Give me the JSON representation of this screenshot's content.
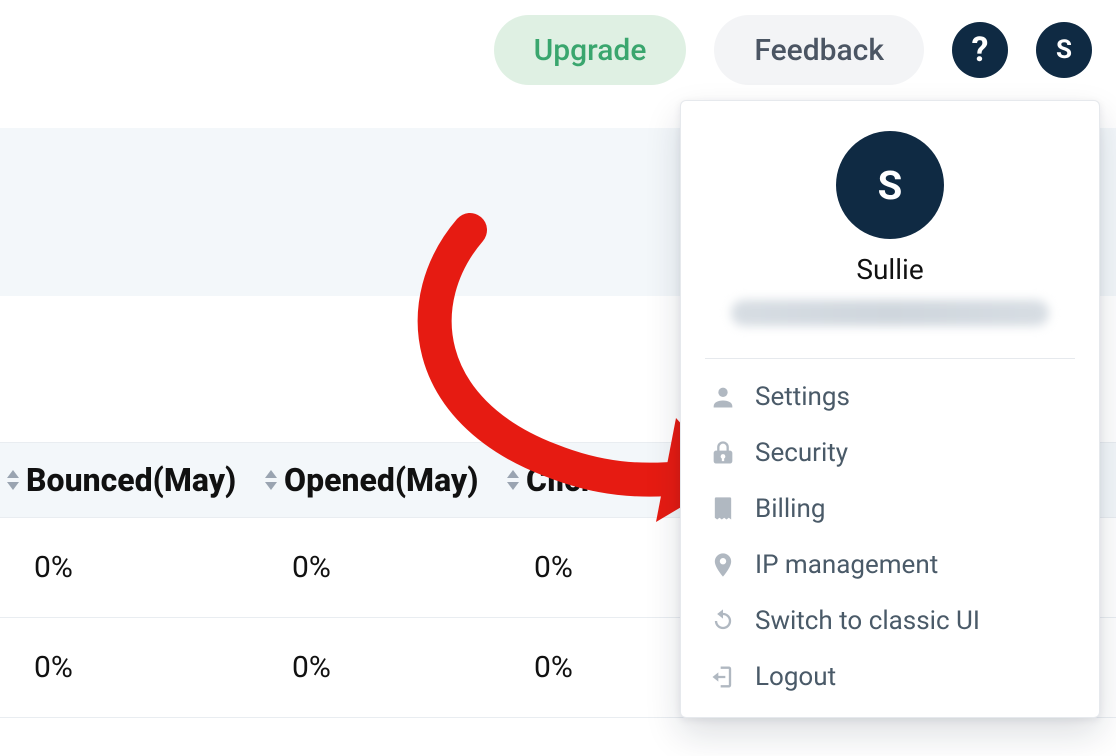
{
  "topbar": {
    "upgrade_label": "Upgrade",
    "feedback_label": "Feedback",
    "help_glyph": "?",
    "avatar_initial": "S"
  },
  "table": {
    "columns": [
      {
        "key": "bounced",
        "label": "Bounced(May)"
      },
      {
        "key": "opened",
        "label": "Opened(May)"
      },
      {
        "key": "clicked",
        "label": "Click"
      }
    ],
    "rows": [
      {
        "bounced": "0%",
        "opened": "0%",
        "clicked": "0%"
      },
      {
        "bounced": "0%",
        "opened": "0%",
        "clicked": "0%"
      }
    ]
  },
  "dropdown": {
    "avatar_initial": "S",
    "name": "Sullie",
    "menu": [
      {
        "id": "settings",
        "label": "Settings",
        "icon": "user"
      },
      {
        "id": "security",
        "label": "Security",
        "icon": "lock"
      },
      {
        "id": "billing",
        "label": "Billing",
        "icon": "receipt"
      },
      {
        "id": "ip",
        "label": "IP management",
        "icon": "pin"
      },
      {
        "id": "classic",
        "label": "Switch to classic UI",
        "icon": "refresh"
      },
      {
        "id": "logout",
        "label": "Logout",
        "icon": "exit"
      }
    ]
  },
  "colors": {
    "accent_green": "#3aa66e",
    "annotation_red": "#e61b12",
    "ink": "#0f2a43"
  }
}
